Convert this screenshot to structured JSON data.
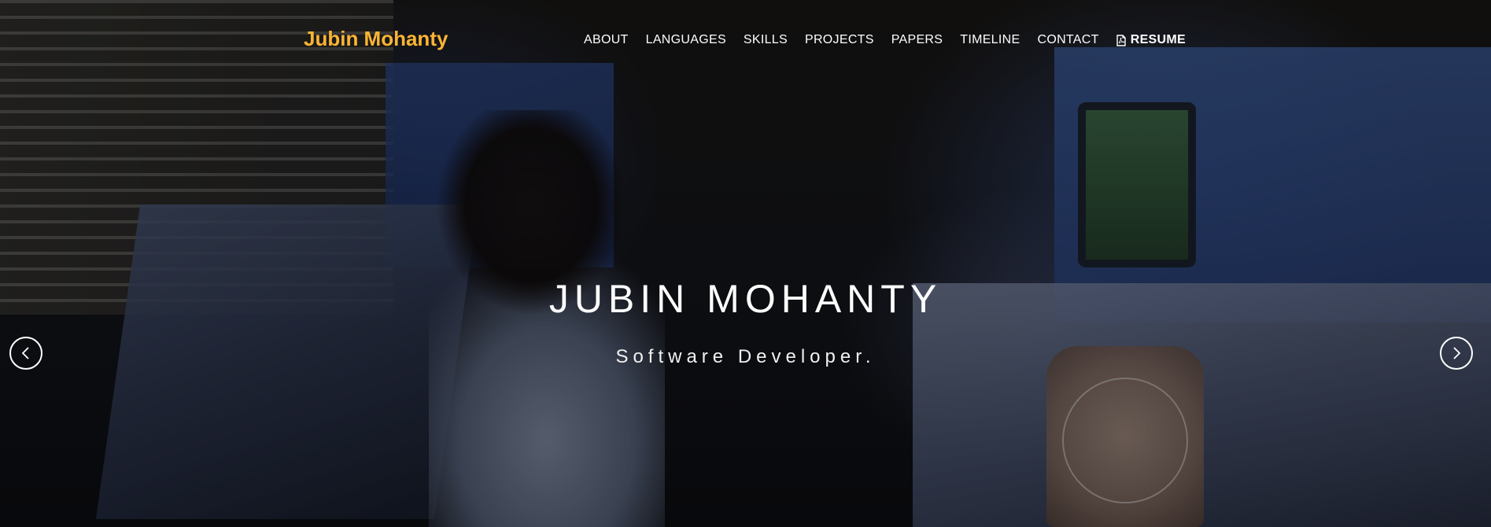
{
  "brand": {
    "name": "Jubin Mohanty",
    "color": "#fcb533"
  },
  "nav": {
    "items": [
      {
        "label": "ABOUT"
      },
      {
        "label": "LANGUAGES"
      },
      {
        "label": "SKILLS"
      },
      {
        "label": "PROJECTS"
      },
      {
        "label": "PAPERS"
      },
      {
        "label": "TIMELINE"
      },
      {
        "label": "CONTACT"
      }
    ],
    "resume": {
      "label": "RESUME",
      "icon": "pdf-file-icon"
    }
  },
  "hero": {
    "title": "JUBIN MOHANTY",
    "subtitle": "Software Developer."
  },
  "carousel": {
    "prev_icon": "chevron-left-icon",
    "next_icon": "chevron-right-icon"
  }
}
